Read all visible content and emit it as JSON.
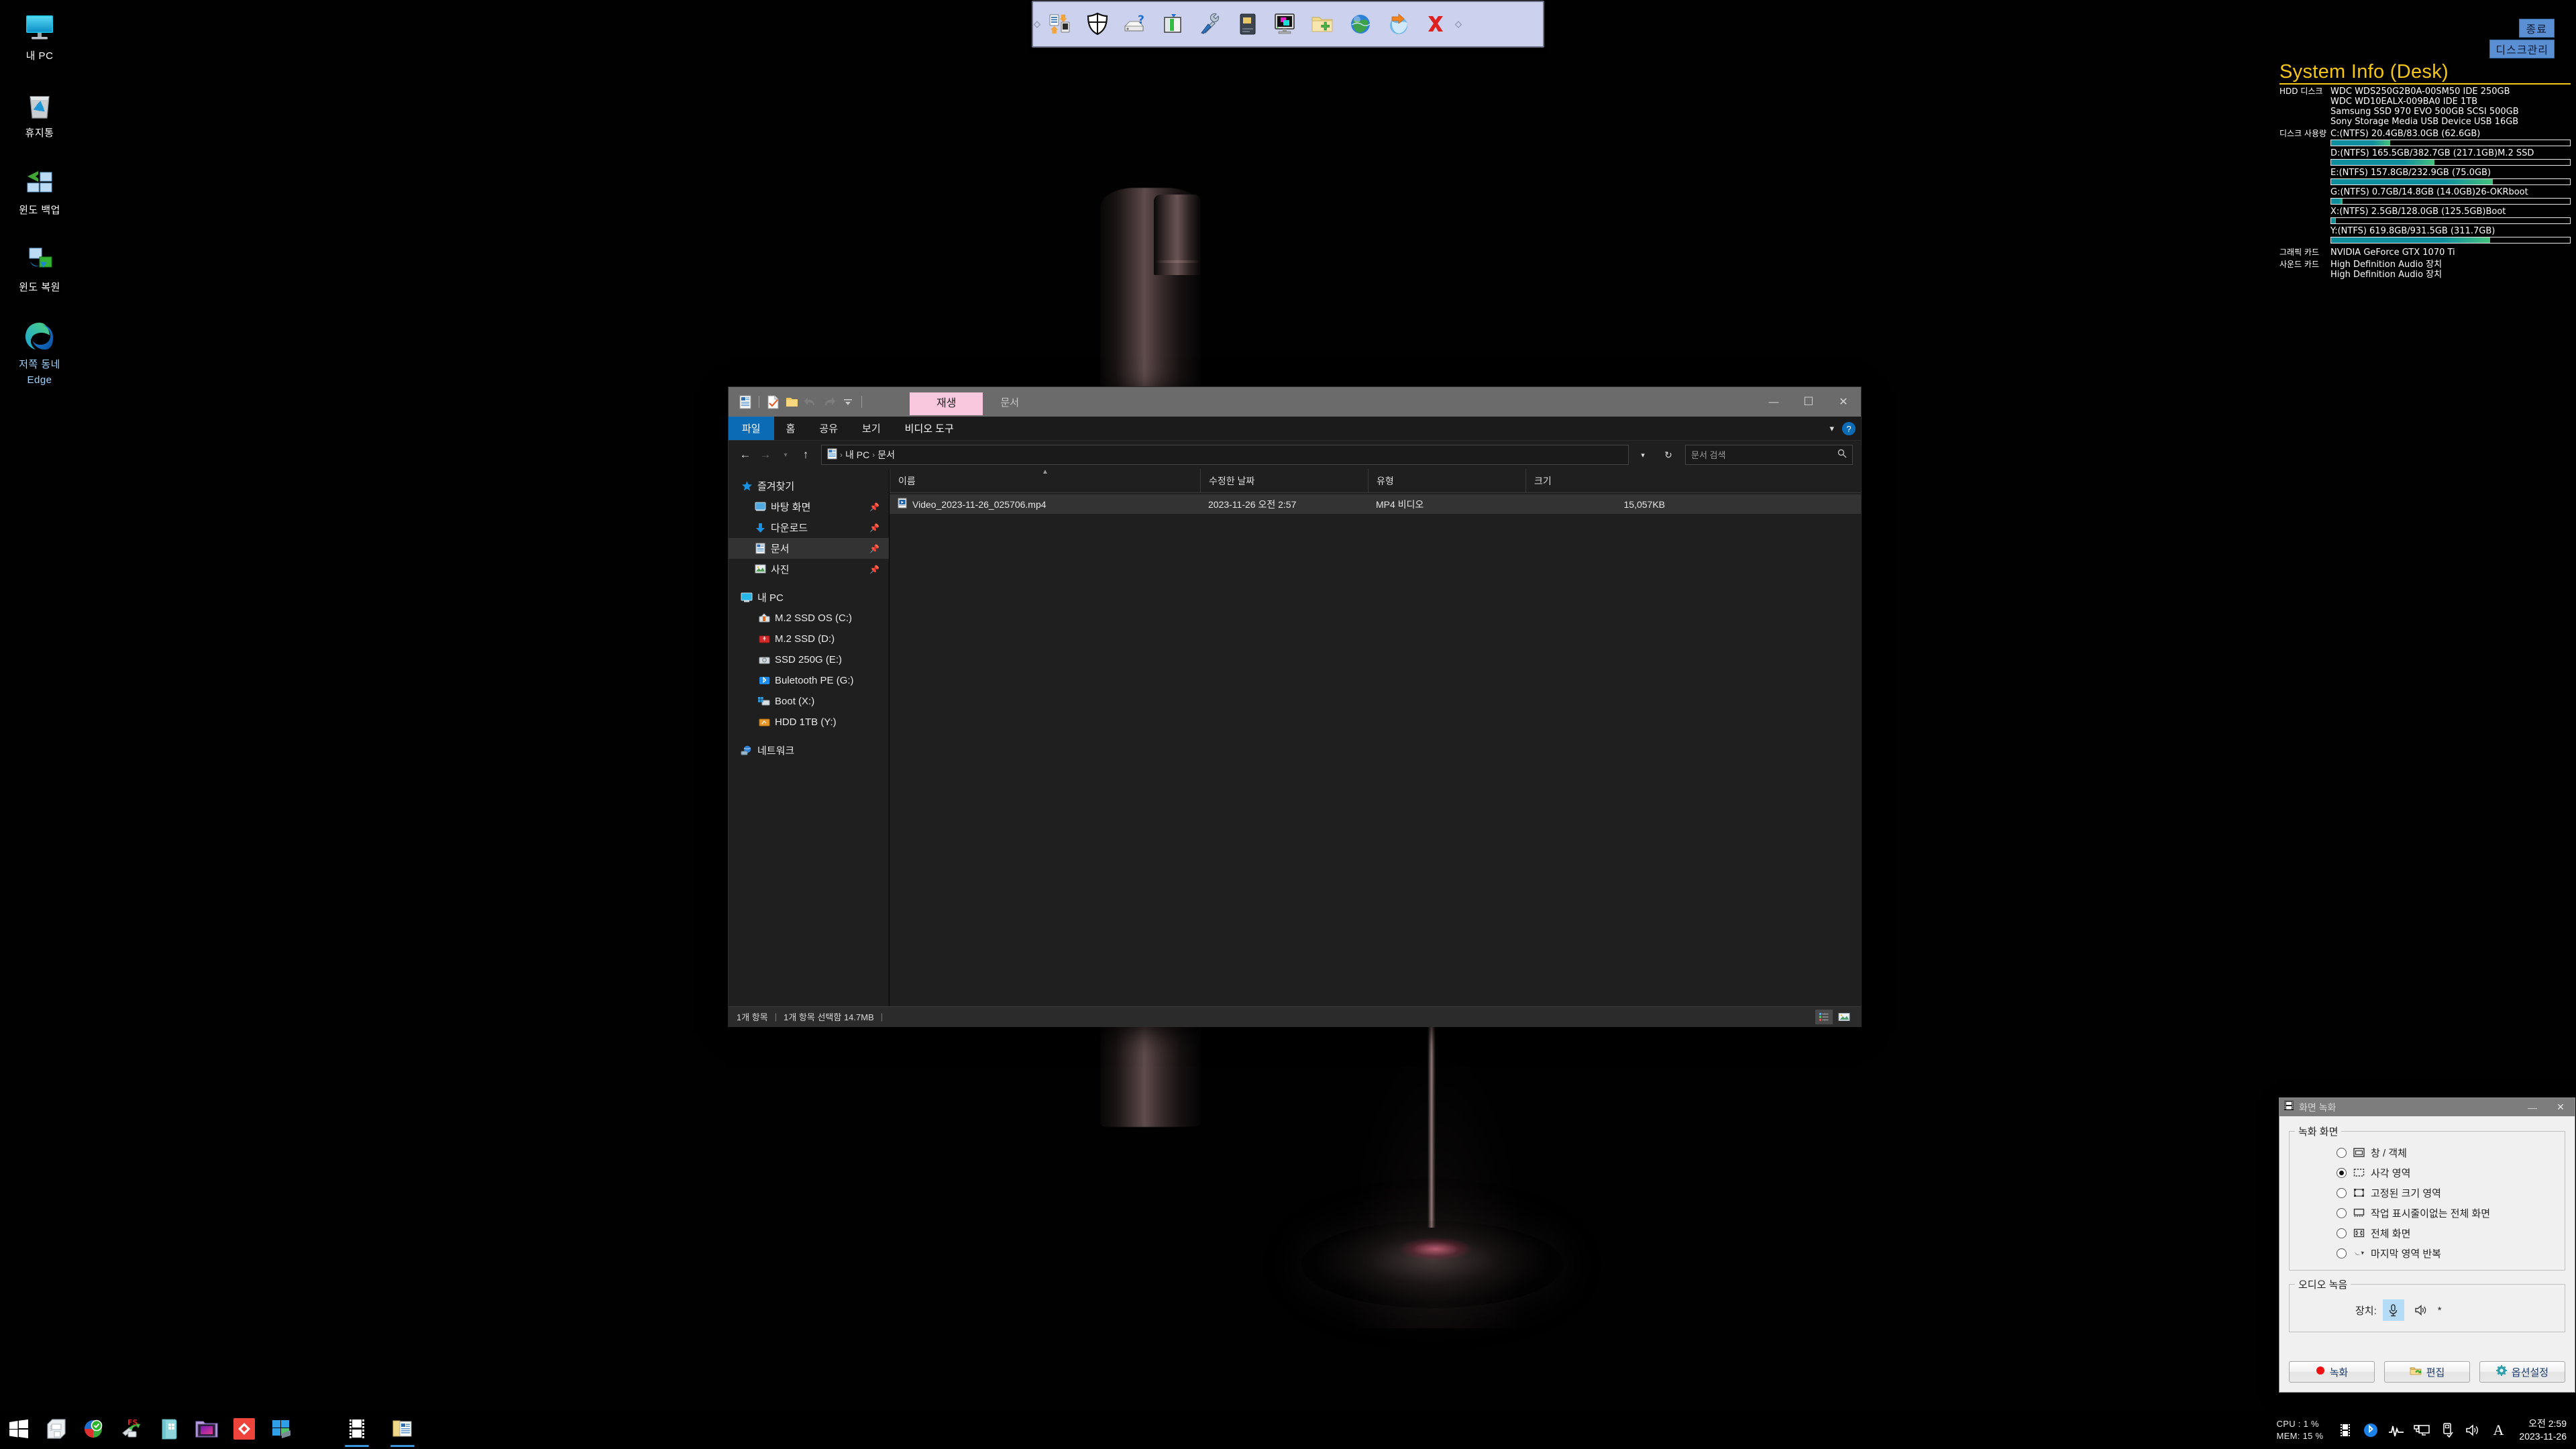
{
  "desktop": {
    "icons": [
      {
        "name": "my-pc",
        "label": "내 PC",
        "icon": "monitor-icon",
        "blue": false
      },
      {
        "name": "recycle-bin",
        "label": "휴지통",
        "icon": "recycle-bin-icon",
        "blue": false
      },
      {
        "name": "windows-backup",
        "label": "윈도 백업",
        "icon": "window-backup-icon",
        "blue": false
      },
      {
        "name": "windows-restore",
        "label": "윈도 복원",
        "icon": "window-restore-icon",
        "blue": false
      },
      {
        "name": "edge",
        "label": "저쪽 동네",
        "label2": "Edge",
        "icon": "edge-icon",
        "blue": true
      }
    ]
  },
  "top_toolbar": {
    "buttons": [
      {
        "name": "transfer-icon",
        "title": "전송"
      },
      {
        "name": "shield-icon",
        "title": "보안"
      },
      {
        "name": "drive-help-icon",
        "title": "드라이브 정보"
      },
      {
        "name": "partition-icon",
        "title": "파티션"
      },
      {
        "name": "tools-icon",
        "title": "도구"
      },
      {
        "name": "disk-icon",
        "title": "디스크"
      },
      {
        "name": "monitor-icon",
        "title": "화면"
      },
      {
        "name": "folder-add-icon",
        "title": "폴더 추가"
      },
      {
        "name": "globe-icon",
        "title": "인터넷"
      },
      {
        "name": "globe-arrow-icon",
        "title": "업로드"
      },
      {
        "name": "close-x-icon",
        "title": "닫기"
      }
    ]
  },
  "sysinfo": {
    "exit_button": "종료",
    "disk_manage_button": "디스크관리",
    "title": "System Info (Desk)",
    "rows": [
      {
        "key": "HDD 디스크",
        "values": [
          "WDC WDS250G2B0A-00SM50 IDE 250GB",
          "WDC WD10EALX-009BA0 IDE 1TB",
          "Samsung SSD 970 EVO 500GB SCSI 500GB",
          "Sony Storage Media USB Device USB 16GB"
        ]
      }
    ],
    "usage_key": "디스크 사용량",
    "usage": [
      {
        "label": "C:(NTFS) 20.4GB/83.0GB (62.6GB)",
        "percent": 24.6
      },
      {
        "label": "D:(NTFS) 165.5GB/382.7GB (217.1GB)M.2 SSD",
        "percent": 43.2
      },
      {
        "label": "E:(NTFS) 157.8GB/232.9GB (75.0GB)",
        "percent": 67.8
      },
      {
        "label": "G:(NTFS) 0.7GB/14.8GB (14.0GB)26-OKRboot",
        "percent": 4.7
      },
      {
        "label": "X:(NTFS) 2.5GB/128.0GB (125.5GB)Boot",
        "percent": 2.0
      },
      {
        "label": "Y:(NTFS) 619.8GB/931.5GB (311.7GB)",
        "percent": 66.5
      }
    ],
    "gpu_key": "그래픽 카드",
    "gpu": "NVIDIA GeForce GTX 1070 Ti",
    "sound_key": "사운드 카드",
    "sound": [
      "High Definition Audio 장치",
      "High Definition Audio 장치"
    ]
  },
  "explorer": {
    "quick_access": [
      {
        "name": "properties-icon"
      },
      {
        "name": "new-item-icon"
      },
      {
        "name": "new-folder-icon"
      },
      {
        "name": "undo-icon"
      },
      {
        "name": "redo-icon"
      },
      {
        "name": "customize-qat-icon"
      }
    ],
    "context_tab": "재생",
    "context_group": "문서",
    "window_buttons": {
      "minimize": "—",
      "maximize": "☐",
      "close": "✕"
    },
    "tabs": [
      {
        "name": "tab-file",
        "label": "파일",
        "active": true
      },
      {
        "name": "tab-home",
        "label": "홈",
        "active": false
      },
      {
        "name": "tab-share",
        "label": "공유",
        "active": false
      },
      {
        "name": "tab-view",
        "label": "보기",
        "active": false
      },
      {
        "name": "tab-video-tools",
        "label": "비디오 도구",
        "active": false
      }
    ],
    "help_label": "?",
    "breadcrumb": [
      "내 PC",
      "문서"
    ],
    "refresh_label": "↻",
    "search": {
      "placeholder": "문서 검색",
      "value": ""
    },
    "nav": [
      {
        "label": "즐겨찾기",
        "icon": "star-icon",
        "indent": 0,
        "pinned": false,
        "selected": false
      },
      {
        "label": "바탕 화면",
        "icon": "desktop-icon",
        "indent": 1,
        "pinned": true,
        "selected": false
      },
      {
        "label": "다운로드",
        "icon": "download-icon",
        "indent": 1,
        "pinned": true,
        "selected": false
      },
      {
        "label": "문서",
        "icon": "document-icon",
        "indent": 1,
        "pinned": true,
        "selected": true
      },
      {
        "label": "사진",
        "icon": "pictures-icon",
        "indent": 1,
        "pinned": true,
        "selected": false
      },
      {
        "label": "내 PC",
        "icon": "monitor-icon",
        "indent": 0,
        "pinned": false,
        "selected": false
      },
      {
        "label": "M.2 SSD OS (C:)",
        "icon": "drive-os-icon",
        "indent": 1,
        "pinned": false,
        "selected": false
      },
      {
        "label": "M.2 SSD (D:)",
        "icon": "drive-usb-red-icon",
        "indent": 1,
        "pinned": false,
        "selected": false
      },
      {
        "label": "SSD 250G (E:)",
        "icon": "drive-icon",
        "indent": 1,
        "pinned": false,
        "selected": false
      },
      {
        "label": "Buletooth PE (G:)",
        "icon": "bluetooth-drive-icon",
        "indent": 1,
        "pinned": false,
        "selected": false
      },
      {
        "label": "Boot (X:)",
        "icon": "drive-boot-icon",
        "indent": 1,
        "pinned": false,
        "selected": false
      },
      {
        "label": "HDD 1TB (Y:)",
        "icon": "drive-orange-icon",
        "indent": 1,
        "pinned": false,
        "selected": false
      },
      {
        "label": "네트워크",
        "icon": "network-icon",
        "indent": 0,
        "pinned": false,
        "selected": false
      }
    ],
    "columns": [
      {
        "label": "이름",
        "key": "name",
        "sorted": true
      },
      {
        "label": "수정한 날짜",
        "key": "date",
        "sorted": false
      },
      {
        "label": "유형",
        "key": "type",
        "sorted": false
      },
      {
        "label": "크기",
        "key": "size",
        "sorted": false
      }
    ],
    "files": [
      {
        "name": "Video_2023-11-26_025706.mp4",
        "date": "2023-11-26 오전 2:57",
        "type": "MP4 비디오",
        "size": "15,057KB",
        "icon": "video-file-icon",
        "selected": true
      }
    ],
    "status": {
      "count": "1개 항목",
      "selection": "1개 항목 선택함 14.7MB"
    },
    "view_buttons": [
      {
        "name": "details-view-button",
        "active": true
      },
      {
        "name": "large-icons-view-button",
        "active": false
      }
    ]
  },
  "recorder": {
    "title": "화면 녹화",
    "minimize": "—",
    "close": "✕",
    "screen_group": "녹화 화면",
    "screen_options": [
      {
        "label": "창 / 객체",
        "icon": "window-object-icon",
        "checked": false
      },
      {
        "label": "사각 영역",
        "icon": "rect-region-icon",
        "checked": true
      },
      {
        "label": "고정된 크기 영역",
        "icon": "fixed-size-icon",
        "checked": false
      },
      {
        "label": "작업 표시줄이없는 전체 화면",
        "icon": "fullscreen-no-taskbar-icon",
        "checked": false
      },
      {
        "label": "전체 화면",
        "icon": "fullscreen-icon",
        "checked": false
      },
      {
        "label": "마지막 영역 반복",
        "icon": "repeat-last-icon",
        "checked": false
      }
    ],
    "audio_group": "오디오 녹음",
    "device_label": "장치:",
    "device_asterisk": "*",
    "buttons": [
      {
        "label": "녹화",
        "icon": "record-dot-icon"
      },
      {
        "label": "편집",
        "icon": "edit-folder-icon"
      },
      {
        "label": "옵션설정",
        "icon": "gear-icon"
      }
    ]
  },
  "taskbar": {
    "items": [
      {
        "name": "start-button",
        "icon": "windows-logo-icon",
        "running": false
      },
      {
        "name": "taskbar-item-floppy",
        "icon": "floppy-icon",
        "running": false
      },
      {
        "name": "taskbar-item-partition",
        "icon": "partition-pie-icon",
        "running": false
      },
      {
        "name": "taskbar-item-fastcopy",
        "icon": "fastcopy-icon",
        "running": false
      },
      {
        "name": "taskbar-item-teal-book",
        "icon": "teal-book-icon",
        "running": false
      },
      {
        "name": "taskbar-item-media-folder",
        "icon": "media-folder-icon",
        "running": false
      },
      {
        "name": "taskbar-item-anydesk",
        "icon": "anydesk-icon",
        "running": false
      },
      {
        "name": "taskbar-item-windows-tiles",
        "icon": "windows-tiles-icon",
        "running": false
      },
      {
        "name": "taskbar-item-screen-recorder",
        "icon": "film-icon",
        "running": true
      },
      {
        "name": "taskbar-item-explorer",
        "icon": "folder-doc-icon",
        "running": true
      }
    ],
    "perf": {
      "cpu": "CPU :   1 %",
      "mem": "MEM: 15 %"
    },
    "tray": [
      {
        "name": "tray-film-icon"
      },
      {
        "name": "tray-bluetooth-icon"
      },
      {
        "name": "tray-pulse-icon"
      },
      {
        "name": "tray-network-icon"
      },
      {
        "name": "tray-usb-icon"
      },
      {
        "name": "tray-volume-icon"
      },
      {
        "name": "tray-ime-icon"
      }
    ],
    "clock": {
      "time": "오전 2:59",
      "date": "2023-11-26"
    }
  }
}
